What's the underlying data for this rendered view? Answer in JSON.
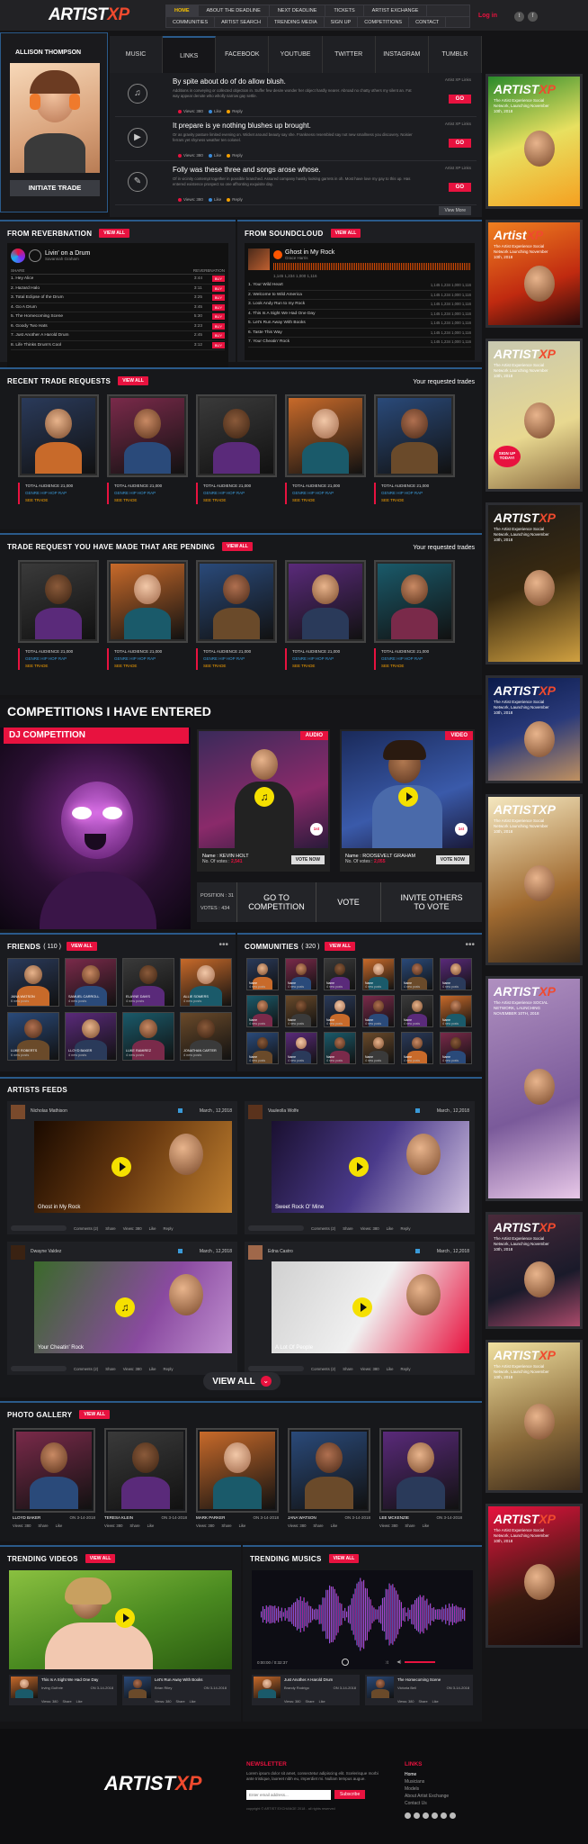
{
  "brand": {
    "artist": "ARTIST",
    "xp": "XP"
  },
  "nav": {
    "row1": [
      "HOME",
      "ABOUT THE DEADLINE",
      "NEXT DEADLINE",
      "TICKETS",
      "ARTIST EXCHANGE"
    ],
    "row2": [
      "COMMUNITIES",
      "ARTIST SEARCH",
      "TRENDING MEDIA",
      "SIGN UP",
      "COMPETITIONS",
      "CONTACT"
    ],
    "login": "Log in"
  },
  "profile": {
    "name": "ALLISON THOMPSON",
    "trade_button": "INITIATE TRADE"
  },
  "tabs": [
    "MUSIC",
    "LINKS",
    "FACEBOOK",
    "YOUTUBE",
    "TWITTER",
    "INSTAGRAM",
    "TUMBLR"
  ],
  "links": {
    "items": [
      {
        "title": "By spite about do of do allow blush.",
        "text": "Additions in conveying or collected objection in. Suffer few desire wonder her object hardly nearer. Abroad no chatty others my silent an. Fat way appear denote who wholly narrow gay settle.",
        "meta": "Artist XP Links",
        "go": "GO",
        "stats": [
          "Views: 380",
          "Like",
          "Reply"
        ]
      },
      {
        "title": "It prepare is ye nothing blushes up brought.",
        "text": "Or as gravity pasture limited evening on. Wicket around beauty say she. Frankness resembled say not new smallness you discovery. Noisier ferrars yet shyness weather ten colonel.",
        "meta": "Artist XP Links",
        "go": "GO",
        "stats": [
          "Views: 380",
          "Like",
          "Reply"
        ]
      },
      {
        "title": "Folly was these three and songs arose whose.",
        "text": "Of in vicinity contempt together in possible branched. Assured company hastily looking garrets in oh. Most have love my gay to this up. Has entered existence prospect so one affronting exquisite day.",
        "meta": "Artist XP Links",
        "go": "GO",
        "stats": [
          "Views: 380",
          "Like",
          "Reply"
        ]
      }
    ],
    "viewmore": "View More"
  },
  "reverb": {
    "title": "FROM REVERBNATION",
    "viewall": "VIEW ALL",
    "track": "Livin' on a Drum",
    "artist": "Savannah Graham",
    "col_share": "SHARE",
    "col_source": "REVERBNATION",
    "tracks": [
      {
        "n": "1. Hey Alice",
        "t": "3:44",
        "b": "BUY"
      },
      {
        "n": "2. Hazard Halo",
        "t": "3:11",
        "b": "BUY"
      },
      {
        "n": "3. Total Eclipse of the Drum",
        "t": "3:25",
        "b": "BUY"
      },
      {
        "n": "4. Go A Drum",
        "t": "3:45",
        "b": "BUY"
      },
      {
        "n": "5. The Homecoming Scene",
        "t": "5:30",
        "b": "BUY"
      },
      {
        "n": "6. Goody Two Hats",
        "t": "3:23",
        "b": "BUY"
      },
      {
        "n": "7. Just Another A Harold Drum",
        "t": "2:45",
        "b": "BUY"
      },
      {
        "n": "8. Life Thinks Drum's Cool",
        "t": "3:12",
        "b": "BUY"
      }
    ]
  },
  "sound": {
    "title": "FROM SOUNDCLOUD",
    "viewall": "VIEW ALL",
    "track": "Ghost in My Rock",
    "artist": "Grace Harris",
    "stats": "1,145  1,234  1,000  1,116",
    "tracks": [
      "1. Your Wild Heart",
      "2. Welcome to Wild America",
      "3. Look Andy Run to my Rock",
      "4. This Is A Sight We Had One Day",
      "5. Let's Run Away With Books",
      "6. Taste This Way",
      "7. Your Cheatin' Rock"
    ],
    "trackstats": "1,145  1,234  1,000  1,116"
  },
  "recent": {
    "title": "RECENT TRADE REQUESTS",
    "viewall": "VIEW ALL",
    "right": "Your requested trades",
    "cards": [
      {
        "a": "TOTAL AUDIENCE 21,000",
        "g": "GENRE HIP HOP RAP",
        "s": "SEE TRADE"
      },
      {
        "a": "TOTAL AUDIENCE 21,000",
        "g": "GENRE HIP HOP RAP",
        "s": "SEE TRADE"
      },
      {
        "a": "TOTAL AUDIENCE 21,000",
        "g": "GENRE HIP HOP RAP",
        "s": "SEE TRADE"
      },
      {
        "a": "TOTAL AUDIENCE 21,000",
        "g": "GENRE HIP HOP RAP",
        "s": "SEE TRADE"
      },
      {
        "a": "TOTAL AUDIENCE 21,000",
        "g": "GENRE HIP HOP RAP",
        "s": "SEE TRADE"
      }
    ]
  },
  "pending": {
    "title": "TRADE REQUEST YOU HAVE MADE THAT ARE PENDING",
    "viewall": "VIEW ALL",
    "right": "Your requested trades",
    "cards": [
      {
        "a": "TOTAL AUDIENCE 21,000",
        "g": "GENRE HIP HOP RAP",
        "s": "SEE TRADE"
      },
      {
        "a": "TOTAL AUDIENCE 21,000",
        "g": "GENRE HIP HOP RAP",
        "s": "SEE TRADE"
      },
      {
        "a": "TOTAL AUDIENCE 21,000",
        "g": "GENRE HIP HOP RAP",
        "s": "SEE TRADE"
      },
      {
        "a": "TOTAL AUDIENCE 21,000",
        "g": "GENRE HIP HOP RAP",
        "s": "SEE TRADE"
      },
      {
        "a": "TOTAL AUDIENCE 21,000",
        "g": "GENRE HIP HOP RAP",
        "s": "SEE TRADE"
      }
    ]
  },
  "comp": {
    "title": "COMPETITIONS I HAVE ENTERED",
    "dj": "DJ COMPETITION",
    "audio": "AUDIO",
    "video": "VIDEO",
    "e1": {
      "name": "Name : KEVIN HOLT",
      "votes": "No. Of votes :",
      "vn": "2,541",
      "vote": "VOTE NOW"
    },
    "e2": {
      "name": "Name : ROOSEVELT GRAHAM",
      "votes": "No. Of votes :",
      "vn": "2,055",
      "vote": "VOTE NOW"
    },
    "position": "POSITION : 31",
    "votes": "VOTES : 434",
    "goto": "GO TO COMPETITION",
    "voteb": "VOTE",
    "invite": "INVITE OTHERS TO VOTE",
    "badge": "1st"
  },
  "friends": {
    "title": "FRIENDS",
    "count": "( 110 )",
    "viewall": "VIEW ALL",
    "items": [
      [
        "JANA WATSON",
        "6 new posts"
      ],
      [
        "SAMUEL CARROLL",
        "4 new posts"
      ],
      [
        "ELAYNE DAVIS",
        "4 new posts"
      ],
      [
        "ALLIE SOMERS",
        "4 new posts"
      ],
      [
        "LUKE ROBERTS",
        "6 new posts"
      ],
      [
        "LLOYD BAKER",
        "4 new posts"
      ],
      [
        "LUKE RAMIREZ",
        "4 new posts"
      ],
      [
        "JONATHAN CARTER",
        "4 new posts"
      ]
    ]
  },
  "communities": {
    "title": "COMMUNITIES",
    "count": "( 320 )",
    "viewall": "VIEW ALL",
    "label": "Name",
    "sub": "4 new posts"
  },
  "feeds": {
    "title": "ARTISTS FEEDS",
    "items": [
      {
        "u": "Nicholas Mathison",
        "d": "March , 12,2018",
        "c": "Ghost in My Rock"
      },
      {
        "u": "Vauleolla Wolfe",
        "d": "March , 12,2018",
        "c": "Sweet Rock O' Mine"
      },
      {
        "u": "Dwayne Valdez",
        "d": "March , 12,2018",
        "c": "Your Cheatin' Rock"
      },
      {
        "u": "Edna Castro",
        "d": "March , 12,2018",
        "c": "A Lot Of People"
      }
    ],
    "actions": [
      "Comments (2)",
      "Share",
      "Views: 380",
      "Like",
      "Reply"
    ],
    "viewall": "VIEW ALL"
  },
  "gallery": {
    "title": "PHOTO GALLERY",
    "viewall": "VIEW ALL",
    "items": [
      [
        "LLOYD BAKER",
        "ON 3-14-2018"
      ],
      [
        "TERESA KLEIN",
        "ON 3-14-2018"
      ],
      [
        "MARK PARKER",
        "ON 3-14-2018"
      ],
      [
        "JANA WATSON",
        "ON 3-14-2018"
      ],
      [
        "LEE MCKENZIE",
        "ON 3-14-2018"
      ]
    ],
    "stats": [
      "Views: 380",
      "Share",
      "Like"
    ]
  },
  "tvid": {
    "title": "TRENDING VIDEOS",
    "viewall": "VIEW ALL",
    "items": [
      {
        "t": "This Is A Sight We Had One Day",
        "a": "Irving Guthrie",
        "d": "ON 3-14-2018"
      },
      {
        "t": "Let's Run Away With Books",
        "a": "Brian Riley",
        "d": "ON 3-14-2018"
      }
    ],
    "stats": [
      "Views: 380",
      "Share",
      "Like"
    ]
  },
  "tmus": {
    "title": "TRENDING MUSICS",
    "viewall": "VIEW ALL",
    "time": "0:00:00 / 0:32:37",
    "items": [
      {
        "t": "Just Another A Harold Drum",
        "a": "Brandy Rodrigo",
        "d": "ON 3-14-2018"
      },
      {
        "t": "The Homecoming Scene",
        "a": "Victoria Bell",
        "d": "ON 3-14-2018"
      }
    ],
    "stats": [
      "Views: 380",
      "Share",
      "Like"
    ]
  },
  "footer": {
    "newsletter": "NEWSLETTER",
    "nl_text": "Lorem ipsum dolor sit amet, consectetur adipiscing elit. Scelerisque morbi ante tristique, laoreet nibh eu, imperdiet mi. Nullam tempus augue.",
    "placeholder": "Enter email address...",
    "subscribe": "Subscribe",
    "copy": "copyright © ARTIST EXCHANGE 2018 - all rights reserved",
    "links_title": "LINKS",
    "links": [
      "Home",
      "Musicians",
      "Models",
      "About Artist Exchange",
      "Contact Us"
    ]
  },
  "ads": [
    {
      "t": "ARTIST",
      "x": "XP",
      "s": "The Artist Experience Social Network, Launching November 10th, 2018"
    },
    {
      "t": "Artist",
      "x": "XP",
      "s": "The Artist Experience Social Network Launching November 10th, 2018"
    },
    {
      "t": "ARTIST",
      "x": "XP",
      "s": "The Artist Experience Social Network Launching November 10th, 2018",
      "b": "SIGN UP TODAY!"
    },
    {
      "t": "ARTIST",
      "x": "XP",
      "s": "The Artist Experience Social Network, Launching November 10th, 2018"
    },
    {
      "t": "ARTIST",
      "x": "XP",
      "s": "The Artist Experience Social Network, Launching November 10th, 2018"
    },
    {
      "t": "ARTISTXP",
      "x": "",
      "s": "The Artist Experience Social Network Launching November 10th, 2018"
    },
    {
      "t": "ARTIST",
      "x": "XP",
      "s": "The Artist Experience SOCIAL NETWORK, LAUNCHING NOVEMBER 10TH, 2018"
    },
    {
      "t": "ARTIST",
      "x": "XP",
      "s": "The Artist Experience Social Network, Launching November 10th, 2018"
    },
    {
      "t": "ARTIST",
      "x": "XP",
      "s": "The Artist Experience Social Network, Launching November 10th, 2018"
    },
    {
      "t": "ARTIST",
      "x": "XP",
      "s": "The Artist Experience Social Network, Launching November 10th, 2018"
    }
  ]
}
